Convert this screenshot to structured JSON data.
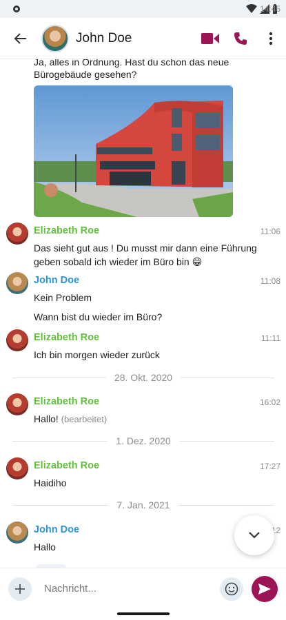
{
  "status_bar": {
    "time": "14:45"
  },
  "header": {
    "contact_name": "John Doe"
  },
  "messages": {
    "partial_text_1": "Ja, alles in Ordnung. Hast du schon das neue",
    "partial_text_2": "Bürogebäude gesehen?",
    "m1": {
      "sender": "Elizabeth Roe",
      "time": "11:06",
      "line1": "Das sieht gut aus ! Du musst mir dann eine Führung",
      "line2": "geben sobald ich wieder im Büro bin 😁"
    },
    "m2": {
      "sender": "John Doe",
      "time": "11:08",
      "line1": "Kein Problem",
      "line2": "Wann bist du wieder im Büro?"
    },
    "m3": {
      "sender": "Elizabeth Roe",
      "time": "11:11",
      "line1": "Ich bin morgen wieder zurück"
    },
    "date1": "28. Okt. 2020",
    "m4": {
      "sender": "Elizabeth Roe",
      "time": "16:02",
      "line1": "Hallo!",
      "edited": "(bearbeitet)"
    },
    "date2": "1. Dez. 2020",
    "m5": {
      "sender": "Elizabeth Roe",
      "time": "17:27",
      "line1": "Haidiho"
    },
    "date3": "7. Jan. 2021",
    "m6": {
      "sender": "John Doe",
      "time": "12",
      "line1": "Hallo"
    }
  },
  "composer": {
    "placeholder": "Nachricht..."
  },
  "colors": {
    "accent": "#9c1456",
    "elizabeth_name": "#62c13b",
    "john_name": "#2b93d6"
  },
  "icons": {
    "back": "arrow-left-icon",
    "video": "video-camera-icon",
    "phone": "phone-icon",
    "menu": "more-vertical-icon",
    "scroll": "chevron-down-icon",
    "add": "plus-icon",
    "emoji": "emoji-icon",
    "send": "send-icon"
  }
}
